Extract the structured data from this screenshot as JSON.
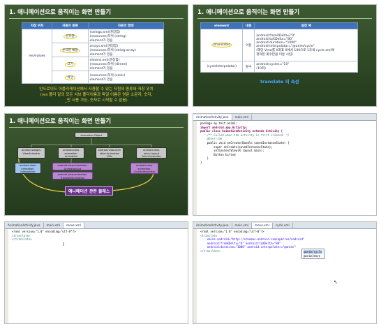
{
  "panels": {
    "slide1": {
      "title": "1. 애니메이션으로 움직이는 화면 만들기",
      "headers": [
        "저장 위치",
        "자원의 종류",
        "자원의 형태"
      ],
      "location": "res/values",
      "rows": [
        {
          "kind": "문자열",
          "desc1": "(strings.xml(권장함)",
          "desc2": "(resources)하위 (string)",
          "desc3": "element가 있음"
        },
        {
          "kind": "문자열 배열",
          "desc1": "arrays.xml(권장함)",
          "desc2": "(resources)하위 (string-array)",
          "desc3": "element가 있음"
        },
        {
          "kind": "크기",
          "desc1": "dimens.xml(권장함)",
          "desc2": "(resources)하위 (dimen)",
          "desc3": "element가 있음"
        },
        {
          "kind": "색상",
          "desc1": "(resources)하위 (color)",
          "desc2": "element가 있음",
          "desc3": ""
        }
      ],
      "caption": [
        "안드로이드 어플리케이션에서 사용할 수 있는 자원의 종류와 저장 위치",
        "(res 폴더 밑의 모든 서브 폴더이름과 파일 이름은 영문 소문자, 숫자,",
        "_만 사용 가능, 숫자로 시작할 수 없음)"
      ]
    },
    "slide2": {
      "title": "1. 애니메이션으로 움직이는 화면 만들기",
      "headers": [
        "element",
        "내용",
        "설정 예"
      ],
      "rows": [
        {
          "element": "(translate)",
          "content": "이동",
          "ex1": "android:fromXDelta=\"0\"",
          "ex2": "android:toXDelta=\"80\"",
          "ex3": "android:duration=\"1000\"",
          "ex4": "android:interpolator=\"@anim/cycle\"",
          "ex5": "(해당 View를 X좌표 0에서 100으로 1초씩 cycle.xml에",
          "ex6": "정의된 횟수만큼 이동 시킴)"
        },
        {
          "element": "(cycleInterpolator)",
          "content": "횟수",
          "ex1": "android:cycles=\"10\"",
          "ex2": "(10회)",
          "ex3": "",
          "ex4": "",
          "ex5": "",
          "ex6": ""
        }
      ],
      "caption": "translate 의 속성"
    },
    "slide3": {
      "title": "1. 애니메이션으로 움직이는 화면 만들기",
      "nodes": {
        "root": "Animation.Object",
        "n1": "android.widget.\nViewAnimator",
        "n2": "android.view.\nanimation.\nAnimation",
        "n3": "android.view.anim\nation.Animation\nUtils",
        "n4": "android.view.\nanim.Layout\nAnimController",
        "n5": "android.view.\nanimation.\nInterpolator",
        "n6": "android.view.animation.\nAnimationSet",
        "n7": "android.view.animation.\nTranslateAnimation",
        "n8": "android.view.\nanimation.\nCycleInterpolator"
      },
      "caption": "애니메이션 관련 클래스"
    },
    "ide1": {
      "tabs": [
        "AnimationActivity.java",
        "main.xml"
      ],
      "lines": [
        "package my.test.anim1;",
        "",
        "import android.app.Activity;",
        "",
        "public class AnimationActivity extends Activity {",
        "    /** Called when the activity is first created. */",
        "    @Override",
        "    public void onCreate(Bundle savedInstanceState) {",
        "        super.onCreate(savedInstanceState);",
        "        setContentView(R.layout.main);",
        "",
        "        Button b=find",
        "    }",
        "}"
      ]
    },
    "ide2": {
      "tabs": [
        "AnimationActivity.java",
        "main.xml",
        "move.xml"
      ],
      "lines": [
        "<?xml version=\"1.0\" encoding=\"utf-8\"?>",
        "<translate>",
        "",
        "",
        "",
        "",
        "",
        "",
        "",
        "</translate>"
      ]
    },
    "ide3": {
      "tabs": [
        "AnimationActivity.java",
        "main.xml",
        "move.xml",
        "cycle.xml"
      ],
      "lines": [
        "<?xml version=\"1.0\" encoding=\"utf-8\"?>",
        "<translate",
        "    xmlns:android=\"http://schemas.android.com/apk/res/android\"",
        "    android:fromXDelta=\"0\" android:toXDelta=\"80\"",
        "    android:duration=\"1000\" android:interpolator=\"@anim/\"",
        "",
        "",
        "",
        "",
        "</translate>"
      ],
      "suggestions": [
        "@anim/cycle",
        "@anim/move"
      ]
    }
  },
  "colors": {
    "slide_green": "#2f4a28",
    "table_header": "#3f72b8",
    "caption_yellow": "#f1d64a",
    "caption_blue": "#4aa6ff",
    "highlight_purple": "#6a2f8c"
  }
}
